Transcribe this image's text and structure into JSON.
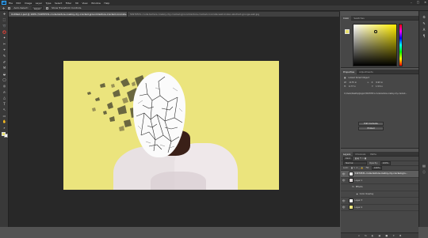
{
  "app": {
    "logo": "Ps",
    "menu": [
      "File",
      "Edit",
      "Image",
      "Layer",
      "Type",
      "Select",
      "Filter",
      "3D",
      "View",
      "Window",
      "Help"
    ],
    "window_controls": [
      "–",
      "□",
      "✕"
    ]
  },
  "options": {
    "auto_select_label": "Auto-Select:",
    "auto_select_value": "Layer",
    "transform_label": "Show Transform Controls"
  },
  "tabs": [
    {
      "label": "Untitled-1.psd @ 100% (54970531-crude-texture-cowboy-dry-cracked-ground-texture-cracked-concrete-wall-broken-abstract-grunge-wall, RGB/8)",
      "active": true
    },
    {
      "label": "54970531-crude-texture-cowboy-dry-cracked-ground-texture-cracked-concrete-wall-broken-abstract-grunge-wall.jpg",
      "active": false
    }
  ],
  "tools": [
    "✛",
    "⬚",
    "➰",
    "⭕",
    "✦",
    "✂",
    "⌖",
    "✎",
    "✐",
    "⚒",
    "◒",
    "◯",
    "◎",
    "✍",
    "△",
    "T",
    "↖",
    "▭",
    "✋",
    "⌕"
  ],
  "color_panel": {
    "tabs": [
      "Color",
      "Swatches"
    ],
    "colors": {
      "fg": "#e9e06a",
      "bg": "#ffffff"
    }
  },
  "properties_panel": {
    "tabs": [
      "Properties",
      "Adjustments"
    ],
    "title": "Linked Smart Object",
    "w_label": "W:",
    "w_value": "1175 in",
    "x_label": "X:",
    "x_value": "9.93 in",
    "h_label": "H:",
    "h_value": "4.77 in",
    "y_label": "Y:",
    "y_value": "1.53 in",
    "path": "C:\\Users\\Desktop\\Jay\\pic\\54970531-crude-texture-cowboy-dry-cracked...",
    "edit_button": "Edit Contents",
    "embed_button": "Embed"
  },
  "layers_panel": {
    "tabs": [
      "Layers",
      "Channels",
      "Paths"
    ],
    "kind_label": "Kind",
    "blend_mode": "Normal",
    "opacity_label": "Opacity:",
    "opacity_value": "100%",
    "lock_label": "Lock:",
    "fill_label": "Fill:",
    "fill_value": "100%",
    "layers": [
      {
        "name": "54970531-crude-texture-cowboy-dry-cracked-gro...",
        "selected": true,
        "thumb": "#e8e8e8",
        "indent": 0
      },
      {
        "name": "Layer 1",
        "selected": false,
        "thumb": "#d8d2d3",
        "indent": 0
      },
      {
        "name": "Effects",
        "selected": false,
        "thumb": "",
        "indent": 1
      },
      {
        "name": "Color Overlay",
        "selected": false,
        "thumb": "",
        "indent": 2
      },
      {
        "name": "Layer 3",
        "selected": false,
        "thumb": "#ffffff",
        "indent": 0
      },
      {
        "name": "Layer 2",
        "selected": false,
        "thumb": "#ebe47d",
        "indent": 0
      }
    ],
    "bottom_icons": [
      "∞",
      "fx",
      "◐",
      "▣",
      "■",
      "☀",
      "✖"
    ]
  }
}
